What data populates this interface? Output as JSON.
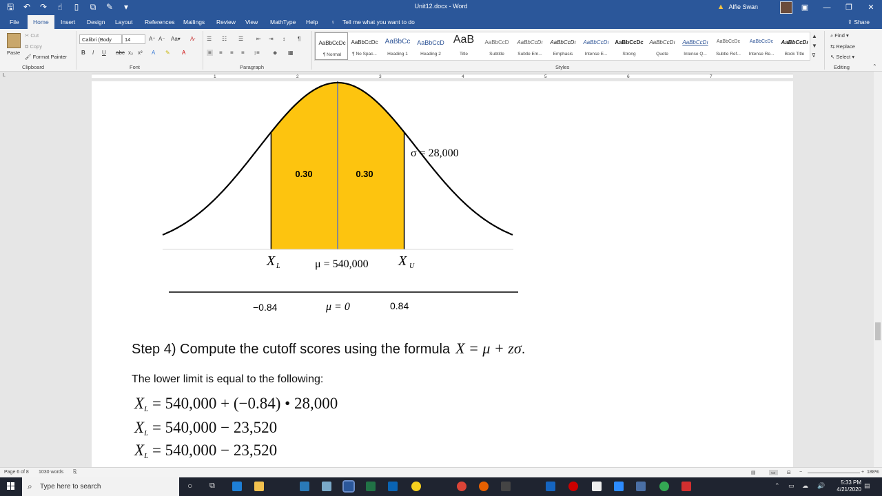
{
  "titlebar": {
    "doc_title": "Unit12.docx - Word",
    "user_name": "Alfie Swan"
  },
  "tabs": [
    {
      "label": "File"
    },
    {
      "label": "Home"
    },
    {
      "label": "Insert"
    },
    {
      "label": "Design"
    },
    {
      "label": "Layout"
    },
    {
      "label": "References"
    },
    {
      "label": "Mailings"
    },
    {
      "label": "Review"
    },
    {
      "label": "View"
    },
    {
      "label": "MathType"
    },
    {
      "label": "Help"
    }
  ],
  "tell_me": "Tell me what you want to do",
  "share": "Share",
  "ribbon": {
    "clipboard": {
      "label": "Clipboard",
      "paste": "Paste",
      "cut": "Cut",
      "copy": "Copy",
      "format_painter": "Format Painter"
    },
    "font": {
      "label": "Font",
      "family": "Calibri (Body",
      "size": "14"
    },
    "paragraph": {
      "label": "Paragraph"
    },
    "styles": {
      "label": "Styles",
      "items": [
        {
          "sample": "AaBbCcDc",
          "name": "¶ Normal"
        },
        {
          "sample": "AaBbCcDc",
          "name": "¶ No Spac..."
        },
        {
          "sample": "AaBbCc",
          "name": "Heading 1"
        },
        {
          "sample": "AaBbCcD",
          "name": "Heading 2"
        },
        {
          "sample": "AaB",
          "name": "Title"
        },
        {
          "sample": "AaBbCcD",
          "name": "Subtitle"
        },
        {
          "sample": "AaBbCcDı",
          "name": "Subtle Em..."
        },
        {
          "sample": "AaBbCcDı",
          "name": "Emphasis"
        },
        {
          "sample": "AaBbCcDı",
          "name": "Intense E..."
        },
        {
          "sample": "AaBbCcDc",
          "name": "Strong"
        },
        {
          "sample": "AaBbCcDı",
          "name": "Quote"
        },
        {
          "sample": "AaBbCcDı",
          "name": "Intense Q..."
        },
        {
          "sample": "AaBbCcDc",
          "name": "Subtle Ref..."
        },
        {
          "sample": "AaBbCcDc",
          "name": "Intense Re..."
        },
        {
          "sample": "AaBbCcDı",
          "name": "Book Title"
        }
      ]
    },
    "editing": {
      "label": "Editing",
      "find": "Find",
      "replace": "Replace",
      "select": "Select"
    }
  },
  "ruler_numbers": [
    "1",
    "2",
    "3",
    "4",
    "5",
    "6",
    "7"
  ],
  "document": {
    "graph": {
      "area_left_label": "0.30",
      "area_right_label": "0.30",
      "sigma_label": "σ = 28,000",
      "xl_label": "X",
      "xl_sub": "L",
      "mu_label": "μ = 540,000",
      "xu_label": "X",
      "xu_sub": "U",
      "z_left": "−0.84",
      "z_mid": "μ = 0",
      "z_right": "0.84",
      "fill_color": "#FDC40F",
      "line_color": "#000000"
    },
    "step_text": "Step 4) Compute the cutoff scores using the formula",
    "step_formula": "X = μ + zσ",
    "step_end": ".",
    "lower_text": "The lower limit is equal to the following:",
    "equations": [
      {
        "lhs": "X",
        "sub": "L",
        "rhs": "= 540,000 + (−0.84) • 28,000"
      },
      {
        "lhs": "X",
        "sub": "L",
        "rhs": "= 540,000 − 23,520"
      },
      {
        "lhs": "X",
        "sub": "L",
        "rhs": "= 540,000 − 23,520"
      }
    ]
  },
  "statusbar": {
    "page": "Page 6 of 8",
    "words": "1030 words",
    "zoom": "188%"
  },
  "taskbar": {
    "search_placeholder": "Type here to search",
    "time": "5:33 PM",
    "date": "4/21/2020"
  }
}
